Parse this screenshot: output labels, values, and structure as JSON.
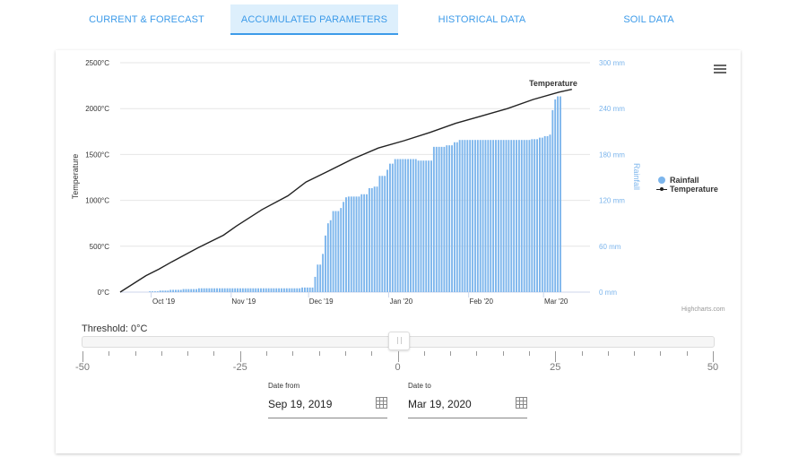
{
  "tabs": [
    {
      "label": "CURRENT & FORECAST",
      "active": false
    },
    {
      "label": "ACCUMULATED PARAMETERS",
      "active": true
    },
    {
      "label": "HISTORICAL DATA",
      "active": false
    },
    {
      "label": "SOIL DATA",
      "active": false
    }
  ],
  "colors": {
    "accent": "#3d9be9",
    "rainfall": "#7cb5ec",
    "temperature": "#222222",
    "axis_right": "#7cb5ec"
  },
  "chart_data": {
    "type": "bar",
    "title": "",
    "x_ticks": [
      "Oct '19",
      "Nov '19",
      "Dec '19",
      "Jan '20",
      "Feb '20",
      "Mar '20"
    ],
    "x_range": [
      "2019-09-19",
      "2020-03-19"
    ],
    "yaxis_left": {
      "title": "Temperature",
      "ticks": [
        "0°C",
        "500°C",
        "1000°C",
        "1500°C",
        "2000°C",
        "2500°C"
      ],
      "range": [
        0,
        2500
      ]
    },
    "yaxis_right": {
      "title": "Rainfall",
      "ticks": [
        "0 mm",
        "60 mm",
        "120 mm",
        "180 mm",
        "240 mm",
        "300 mm"
      ],
      "range": [
        0,
        300
      ]
    },
    "grid": true,
    "legend": {
      "position": "right",
      "items": [
        "Rainfall",
        "Temperature"
      ]
    },
    "series": [
      {
        "name": "Rainfall",
        "type": "column",
        "axis": "right",
        "unit": "mm",
        "segments": [
          {
            "days": 11,
            "value": 0
          },
          {
            "days": 4,
            "value": 1
          },
          {
            "days": 4,
            "value": 2
          },
          {
            "days": 5,
            "value": 3
          },
          {
            "days": 6,
            "value": 4
          },
          {
            "days": 40,
            "value": 5
          },
          {
            "days": 5,
            "value": 6
          },
          {
            "days": 1,
            "value": 20
          },
          {
            "days": 2,
            "value": 36
          },
          {
            "days": 1,
            "value": 50
          },
          {
            "days": 1,
            "value": 74
          },
          {
            "days": 1,
            "value": 90
          },
          {
            "days": 1,
            "value": 94
          },
          {
            "days": 3,
            "value": 106
          },
          {
            "days": 1,
            "value": 110
          },
          {
            "days": 1,
            "value": 118
          },
          {
            "days": 1,
            "value": 124
          },
          {
            "days": 5,
            "value": 125
          },
          {
            "days": 3,
            "value": 128
          },
          {
            "days": 2,
            "value": 136
          },
          {
            "days": 2,
            "value": 138
          },
          {
            "days": 3,
            "value": 152
          },
          {
            "days": 1,
            "value": 160
          },
          {
            "days": 2,
            "value": 168
          },
          {
            "days": 9,
            "value": 174
          },
          {
            "days": 6,
            "value": 172
          },
          {
            "days": 5,
            "value": 190
          },
          {
            "days": 3,
            "value": 192
          },
          {
            "days": 2,
            "value": 196
          },
          {
            "days": 28,
            "value": 199
          },
          {
            "days": 3,
            "value": 200
          },
          {
            "days": 2,
            "value": 202
          },
          {
            "days": 2,
            "value": 204
          },
          {
            "days": 1,
            "value": 206
          },
          {
            "days": 1,
            "value": 238
          },
          {
            "days": 1,
            "value": 252
          },
          {
            "days": 2,
            "value": 256
          }
        ]
      },
      {
        "name": "Temperature",
        "type": "line",
        "axis": "left",
        "unit": "°C",
        "data_label": "Temperature",
        "points": [
          [
            0,
            0
          ],
          [
            10,
            180
          ],
          [
            15,
            250
          ],
          [
            20,
            330
          ],
          [
            30,
            480
          ],
          [
            40,
            620
          ],
          [
            45,
            720
          ],
          [
            55,
            900
          ],
          [
            65,
            1050
          ],
          [
            72,
            1200
          ],
          [
            80,
            1310
          ],
          [
            90,
            1450
          ],
          [
            100,
            1570
          ],
          [
            110,
            1650
          ],
          [
            120,
            1740
          ],
          [
            130,
            1840
          ],
          [
            140,
            1920
          ],
          [
            150,
            2000
          ],
          [
            160,
            2100
          ],
          [
            170,
            2180
          ],
          [
            175,
            2210
          ]
        ]
      }
    ]
  },
  "chart_menu": {
    "icon": "hamburger-menu-icon"
  },
  "credits": "Highcharts.com",
  "threshold": {
    "label": "Threshold: 0°C",
    "value": 0,
    "min": -50,
    "max": 50,
    "major_labels": [
      "-50",
      "-25",
      "0",
      "25",
      "50"
    ]
  },
  "date_from": {
    "label": "Date from",
    "value": "Sep 19, 2019",
    "icon": "calendar-icon"
  },
  "date_to": {
    "label": "Date to",
    "value": "Mar 19, 2020",
    "icon": "calendar-icon"
  }
}
